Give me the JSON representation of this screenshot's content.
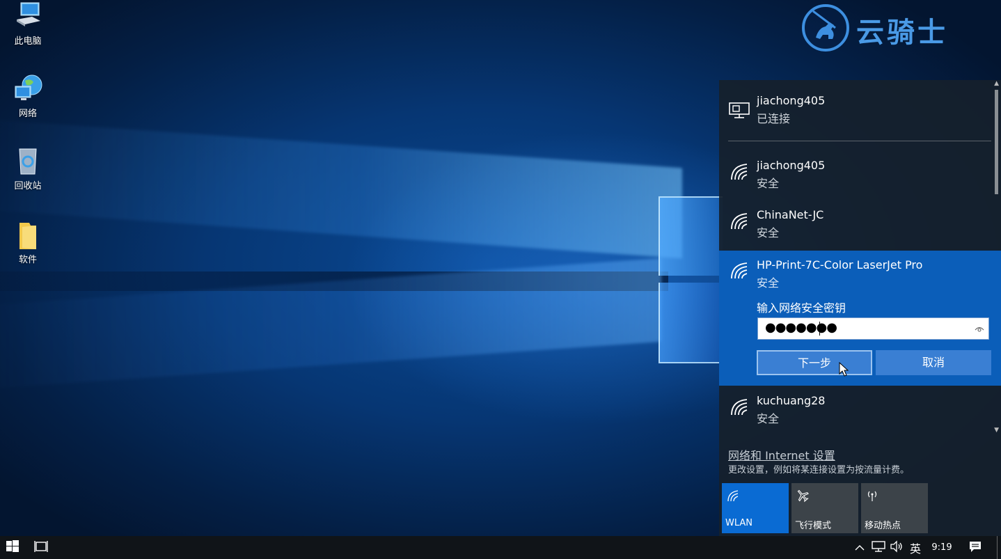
{
  "desktop": {
    "icons": [
      {
        "label": "此电脑",
        "icon": "computer-icon"
      },
      {
        "label": "网络",
        "icon": "network-globe-icon"
      },
      {
        "label": "回收站",
        "icon": "recycle-bin-icon"
      },
      {
        "label": "软件",
        "icon": "folder-icon"
      }
    ]
  },
  "logo": {
    "text": "云骑士",
    "icon": "knight-rider-logo"
  },
  "flyout": {
    "connected": {
      "name": "jiachong405",
      "status": "已连接",
      "icon": "ethernet-icon"
    },
    "networks": [
      {
        "name": "jiachong405",
        "status": "安全",
        "icon": "wifi-icon"
      },
      {
        "name": "ChinaNet-JC",
        "status": "安全",
        "icon": "wifi-icon"
      },
      {
        "name": "HP-Print-7C-Color LaserJet Pro",
        "status": "安全",
        "icon": "wifi-icon"
      },
      {
        "name": "kuchuang28",
        "status": "安全",
        "icon": "wifi-icon"
      }
    ],
    "key_prompt": "输入网络安全密钥",
    "key_value": "●●●●●●●",
    "next_label": "下一步",
    "cancel_label": "取消",
    "settings_link": "网络和 Internet 设置",
    "settings_desc": "更改设置，例如将某连接设置为按流量计费。",
    "tiles": [
      {
        "label": "WLAN",
        "icon": "wifi-icon",
        "active": true
      },
      {
        "label": "飞行模式",
        "icon": "airplane-icon",
        "active": false
      },
      {
        "label": "移动热点",
        "icon": "hotspot-icon",
        "active": false
      }
    ]
  },
  "taskbar": {
    "ime": "英",
    "time": "9:19",
    "icons": [
      "start-icon",
      "task-view-icon",
      "chevron-up-icon",
      "network-tray-icon",
      "volume-icon",
      "action-center-icon"
    ]
  },
  "colors": {
    "accent": "#0b5eb9",
    "tile_active": "#0a6bd3",
    "flyout_bg": "#16202c"
  }
}
